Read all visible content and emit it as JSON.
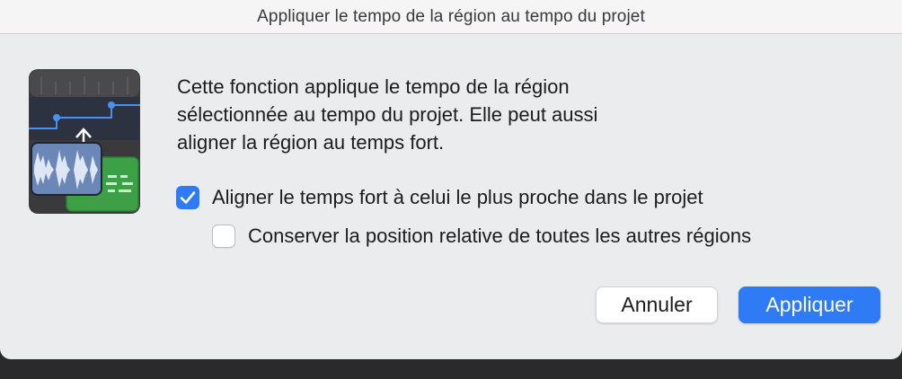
{
  "window": {
    "title": "Appliquer le tempo de la région au tempo du projet"
  },
  "app_icon": {
    "name": "tempo-region-icon"
  },
  "description": {
    "lines": [
      "Cette fonction applique le tempo de la région",
      "sélectionnée au tempo du projet. Elle peut aussi",
      "aligner la région au temps fort."
    ]
  },
  "options": {
    "align_downbeat": {
      "label": "Aligner le temps fort à celui le plus proche dans le projet",
      "checked": true
    },
    "keep_relative_position": {
      "label": "Conserver la position relative de toutes les autres régions",
      "checked": false
    }
  },
  "buttons": {
    "cancel_label": "Annuler",
    "apply_label": "Appliquer"
  },
  "colors": {
    "accent": "#2f7bf5",
    "dialog_background": "#ebeced"
  }
}
